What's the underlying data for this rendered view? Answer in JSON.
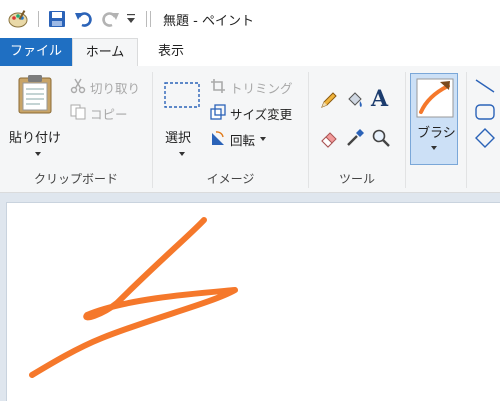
{
  "window": {
    "title": "無題 - ペイント"
  },
  "tabs": {
    "file": "ファイル",
    "home": "ホーム",
    "view": "表示"
  },
  "clipboard": {
    "paste": "貼り付け",
    "cut": "切り取り",
    "copy": "コピー",
    "group_label": "クリップボード"
  },
  "image": {
    "select": "選択",
    "crop": "トリミング",
    "resize": "サイズ変更",
    "rotate": "回転",
    "group_label": "イメージ"
  },
  "tools": {
    "group_label": "ツール"
  },
  "brushes": {
    "label": "ブラシ"
  },
  "stroke_color": "#f5782b",
  "accent_color": "#1f6fc2"
}
